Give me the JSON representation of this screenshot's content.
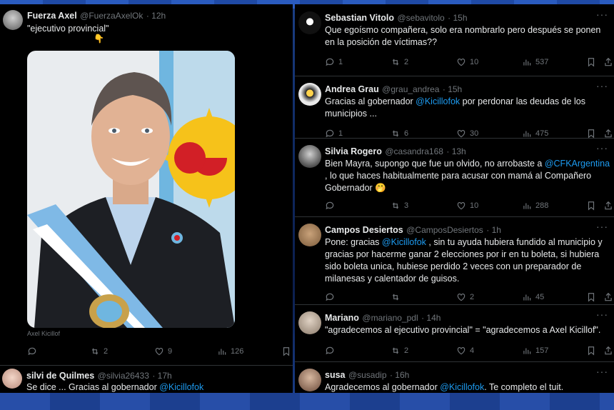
{
  "left_tweet": {
    "name": "Fuerza Axel",
    "handle": "@FuerzaAxelOk",
    "time": "· 12h",
    "text": "\"ejecutivo provincial\"",
    "emoji": "👇",
    "image_caption": "Axel Kicillof",
    "replies": "",
    "retweets": "2",
    "likes": "9",
    "views": "126"
  },
  "bottom_left_tweet": {
    "name": "silvi de Quilmes",
    "handle": "@silvia26433",
    "time": "· 17h",
    "text": "Se dice ... Gracias al gobernador ",
    "mention": "@Kicillofok"
  },
  "replies": [
    {
      "name": "Sebastian Vitolo",
      "handle": "@sebavitolo",
      "time": "· 15h",
      "text_parts": [
        "Que egoísmo compañera, solo era nombrarlo pero después se ponen en la posición de víctimas??"
      ],
      "replies": "1",
      "retweets": "2",
      "likes": "10",
      "views": "537"
    },
    {
      "name": "Andrea Grau",
      "handle": "@grau_andrea",
      "time": "· 15h",
      "text_parts": [
        "Gracias al gobernador ",
        "@Kicillofok",
        " por perdonar las deudas  de los municipios ..."
      ],
      "replies": "1",
      "retweets": "6",
      "likes": "30",
      "views": "475"
    },
    {
      "name": "Silvia Rogero",
      "handle": "@casandra168",
      "time": "· 13h",
      "text_parts": [
        "Bien Mayra, supongo que fue un olvido, no arrobaste a ",
        "@CFKArgentina",
        " , lo que haces habitualmente para acusar con mamá al Compañero Gobernador 🤭"
      ],
      "replies": "",
      "retweets": "3",
      "likes": "10",
      "views": "288"
    },
    {
      "name": "Campos Desiertos",
      "handle": "@CamposDesiertos",
      "time": "· 1h",
      "text_parts": [
        "Pone: gracias ",
        "@Kicillofok",
        " , sin tu ayuda hubiera fundido al municipio y gracias por hacerme ganar 2 elecciones por ir en tu boleta, si hubiera sido boleta unica, hubiese perdido 2 veces con un preparador de milanesas y calentador de guisos."
      ],
      "replies": "",
      "retweets": "",
      "likes": "2",
      "views": "45"
    },
    {
      "name": "Mariano",
      "handle": "@mariano_pdl",
      "time": "· 14h",
      "text_parts": [
        "\"agradecemos al ejecutivo provincial\" = \"agradecemos a Axel Kicillof\"."
      ],
      "replies": "",
      "retweets": "2",
      "likes": "4",
      "views": "157"
    },
    {
      "name": "susa",
      "handle": "@susadip",
      "time": "· 16h",
      "text_parts": [
        "Agradecemos al gobernador ",
        "@Kicillofok",
        ". Te completo el tuit."
      ]
    }
  ],
  "more_label": "···",
  "colors": {
    "link": "#1d9bf0",
    "muted": "#71767b",
    "background": "#000000",
    "frame_blue": "#1b3f86"
  }
}
